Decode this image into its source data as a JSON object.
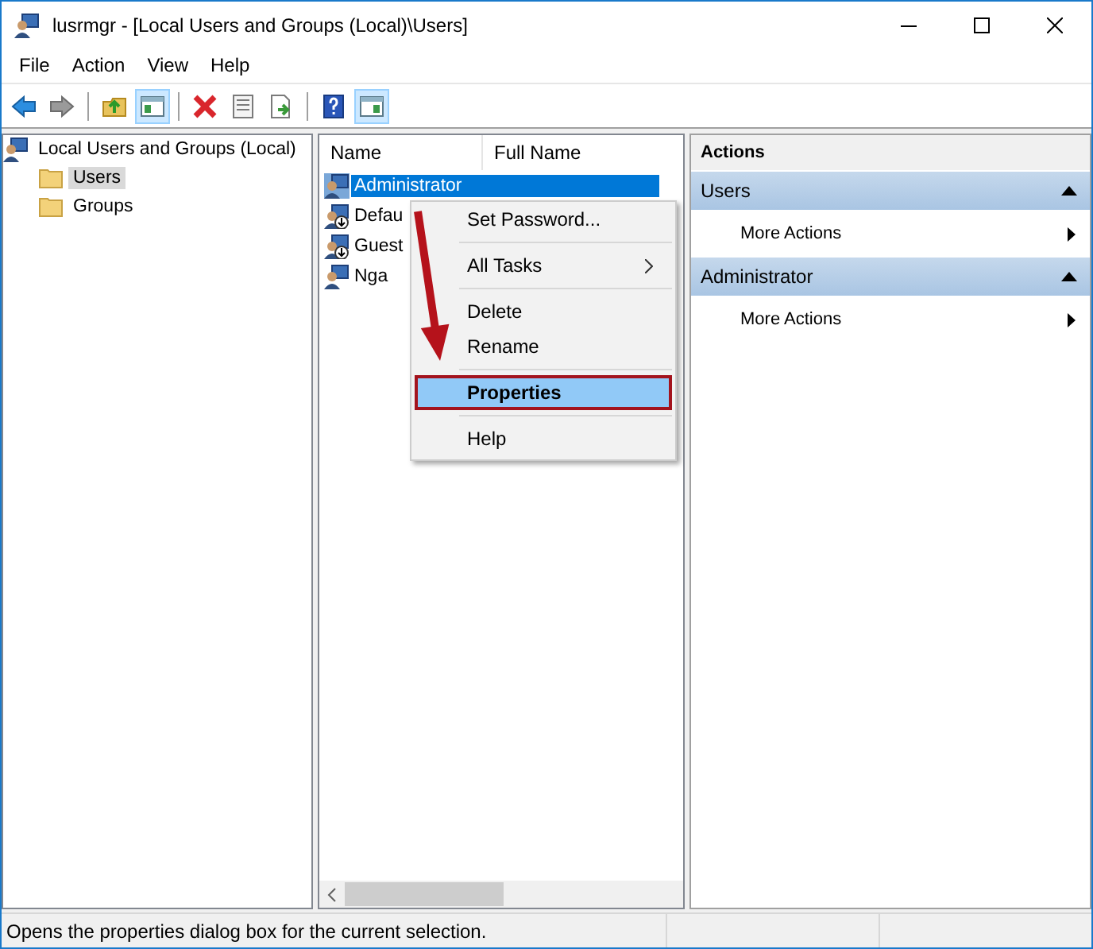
{
  "window": {
    "title": "lusrmgr - [Local Users and Groups (Local)\\Users]"
  },
  "menu_bar": [
    "File",
    "Action",
    "View",
    "Help"
  ],
  "toolbar": [
    {
      "kind": "back",
      "pressed": false
    },
    {
      "kind": "forward",
      "pressed": false
    },
    {
      "kind": "separator"
    },
    {
      "kind": "up",
      "pressed": false
    },
    {
      "kind": "tree",
      "pressed": true
    },
    {
      "kind": "separator"
    },
    {
      "kind": "delete",
      "pressed": false
    },
    {
      "kind": "properties",
      "pressed": false
    },
    {
      "kind": "export",
      "pressed": false
    },
    {
      "kind": "separator"
    },
    {
      "kind": "help",
      "pressed": false
    },
    {
      "kind": "actionpane",
      "pressed": true
    }
  ],
  "tree": [
    {
      "label": "Local Users and Groups (Local)",
      "selected": false,
      "children": [
        {
          "label": "Users",
          "selected": true
        },
        {
          "label": "Groups",
          "selected": false
        }
      ]
    }
  ],
  "list": {
    "columns": [
      "Name",
      "Full Name"
    ],
    "rows": [
      {
        "name": "Administrator",
        "selected": true,
        "disabled": false
      },
      {
        "name": "Defau",
        "selected": false,
        "disabled": true
      },
      {
        "name": "Guest",
        "selected": false,
        "disabled": true
      },
      {
        "name": "Nga",
        "selected": false,
        "disabled": false
      }
    ]
  },
  "context_menu": [
    {
      "kind": "item",
      "label": "Set Password...",
      "selected": false
    },
    {
      "kind": "separator"
    },
    {
      "kind": "submenu",
      "label": "All Tasks",
      "selected": false
    },
    {
      "kind": "separator"
    },
    {
      "kind": "item",
      "label": "Delete",
      "selected": false
    },
    {
      "kind": "item",
      "label": "Rename",
      "selected": false
    },
    {
      "kind": "separator"
    },
    {
      "kind": "item",
      "label": "Properties",
      "selected": true
    },
    {
      "kind": "separator"
    },
    {
      "kind": "item",
      "label": "Help",
      "selected": false
    }
  ],
  "actions": {
    "title": "Actions",
    "sections": [
      {
        "title": "Users",
        "expanded": true,
        "items": [
          "More Actions"
        ]
      },
      {
        "title": "Administrator",
        "expanded": true,
        "items": [
          "More Actions"
        ]
      }
    ]
  },
  "annotations": [
    {
      "kind": "arrow"
    }
  ],
  "status_bar": {
    "text": "Opens the properties dialog box for the current selection."
  }
}
